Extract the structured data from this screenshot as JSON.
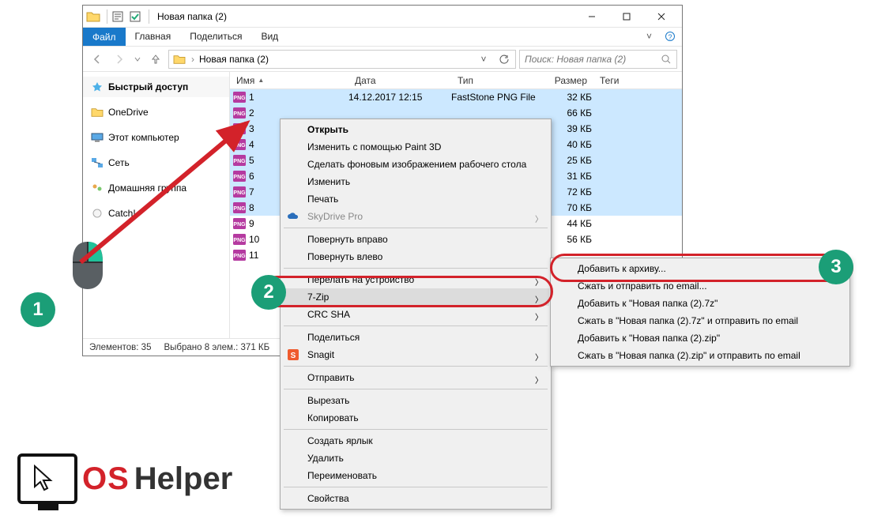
{
  "titlebar": {
    "title": "Новая папка (2)"
  },
  "ribbon": {
    "file": "Файл",
    "home": "Главная",
    "share": "Поделиться",
    "view": "Вид"
  },
  "breadcrumb": {
    "root": "Новая папка (2)"
  },
  "search": {
    "placeholder": "Поиск: Новая папка (2)"
  },
  "columns": {
    "name": "Имя",
    "date": "Дата",
    "type": "Тип",
    "size": "Размер",
    "tags": "Теги"
  },
  "sidebar": {
    "quick": "Быстрый доступ",
    "onedrive": "OneDrive",
    "thispc": "Этот компьютер",
    "network": "Сеть",
    "homegroup": "Домашняя группа",
    "catch": "Catch!"
  },
  "files": [
    {
      "name": "1",
      "date": "14.12.2017 12:15",
      "type": "FastStone PNG File",
      "size": "32 КБ",
      "selected": true
    },
    {
      "name": "2",
      "date": "",
      "type": "",
      "size": "66 КБ",
      "selected": true
    },
    {
      "name": "3",
      "date": "",
      "type": "",
      "size": "39 КБ",
      "selected": true
    },
    {
      "name": "4",
      "date": "",
      "type": "",
      "size": "40 КБ",
      "selected": true
    },
    {
      "name": "5",
      "date": "",
      "type": "",
      "size": "25 КБ",
      "selected": true
    },
    {
      "name": "6",
      "date": "",
      "type": "",
      "size": "31 КБ",
      "selected": true
    },
    {
      "name": "7",
      "date": "",
      "type": "",
      "size": "72 КБ",
      "selected": true
    },
    {
      "name": "8",
      "date": "",
      "type": "",
      "size": "70 КБ",
      "selected": true
    },
    {
      "name": "9",
      "date": "",
      "type": "",
      "size": "44 КБ",
      "selected": false
    },
    {
      "name": "10",
      "date": "",
      "type": "",
      "size": "56 КБ",
      "selected": false
    },
    {
      "name": "11",
      "date": "",
      "type": "",
      "size": "",
      "selected": false
    }
  ],
  "status": {
    "items": "Элементов: 35",
    "selected": "Выбрано 8 элем.: 371 КБ"
  },
  "ctx": {
    "open": "Открыть",
    "paint3d": "Изменить с помощью Paint 3D",
    "wallpaper": "Сделать фоновым изображением рабочего стола",
    "edit": "Изменить",
    "print": "Печать",
    "skydrive": "SkyDrive Pro",
    "rotr": "Повернуть вправо",
    "rotl": "Повернуть влево",
    "cast": "Перелать на устройство",
    "sevenzip": "7-Zip",
    "crcsha": "CRC SHA",
    "share": "Поделиться",
    "snagit": "Snagit",
    "send": "Отправить",
    "cut": "Вырезать",
    "copy": "Копировать",
    "shortcut": "Создать ярлык",
    "delete": "Удалить",
    "rename": "Переименовать",
    "props": "Свойства"
  },
  "sub": {
    "add": "Добавить к архиву...",
    "compemail": "Сжать и отправить по email...",
    "add7z": "Добавить к \"Новая папка (2).7z\"",
    "comp7zemail": "Сжать в \"Новая папка (2).7z\" и отправить по email",
    "addzip": "Добавить к \"Новая папка (2).zip\"",
    "compzipemail": "Сжать в \"Новая папка (2).zip\" и отправить по email"
  },
  "annotations": {
    "step1": "1",
    "step2": "2",
    "step3": "3"
  },
  "logo": {
    "os": "OS",
    "helper": "Helper"
  }
}
